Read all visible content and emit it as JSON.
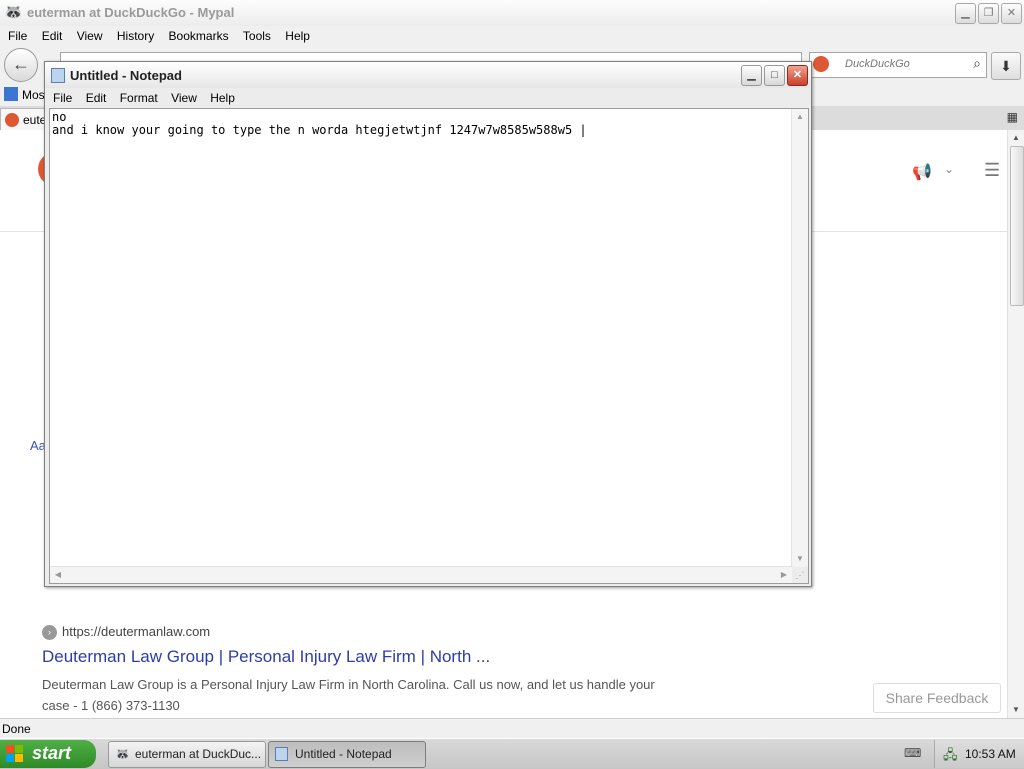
{
  "browser": {
    "title": "euterman at DuckDuckGo - Mypal",
    "menu": [
      "File",
      "Edit",
      "View",
      "History",
      "Bookmarks",
      "Tools",
      "Help"
    ],
    "search_placeholder": "DuckDuckGo",
    "bookmark_label": "Most",
    "tab_label": "eute",
    "status": "Done"
  },
  "page": {
    "side_fragment": "Aa",
    "result": {
      "url": "https://deutermanlaw.com",
      "title": "Deuterman Law Group | Personal Injury Law Firm | North ...",
      "snippet": "Deuterman Law Group is a Personal Injury Law Firm in North Carolina. Call us now, and let us handle your case - 1 (866) 373-1130"
    },
    "share_feedback": "Share Feedback"
  },
  "notepad": {
    "title": "Untitled - Notepad",
    "menu": [
      "File",
      "Edit",
      "Format",
      "View",
      "Help"
    ],
    "text": "no\nand i know your going to type the n worda htegjetwtjnf 1247w7w8585w588w5 |"
  },
  "taskbar": {
    "start_label": "start",
    "tasks": [
      {
        "label": "euterman at DuckDuc...",
        "icon": "mypal-icon"
      },
      {
        "label": "Untitled - Notepad",
        "icon": "notepad-icon"
      }
    ],
    "clock": "10:53 AM"
  },
  "colors": {
    "accent_link": "#2c3da8",
    "start_green": "#3d9e35",
    "close_red": "#c8402b",
    "ddg_orange": "#de5833"
  }
}
